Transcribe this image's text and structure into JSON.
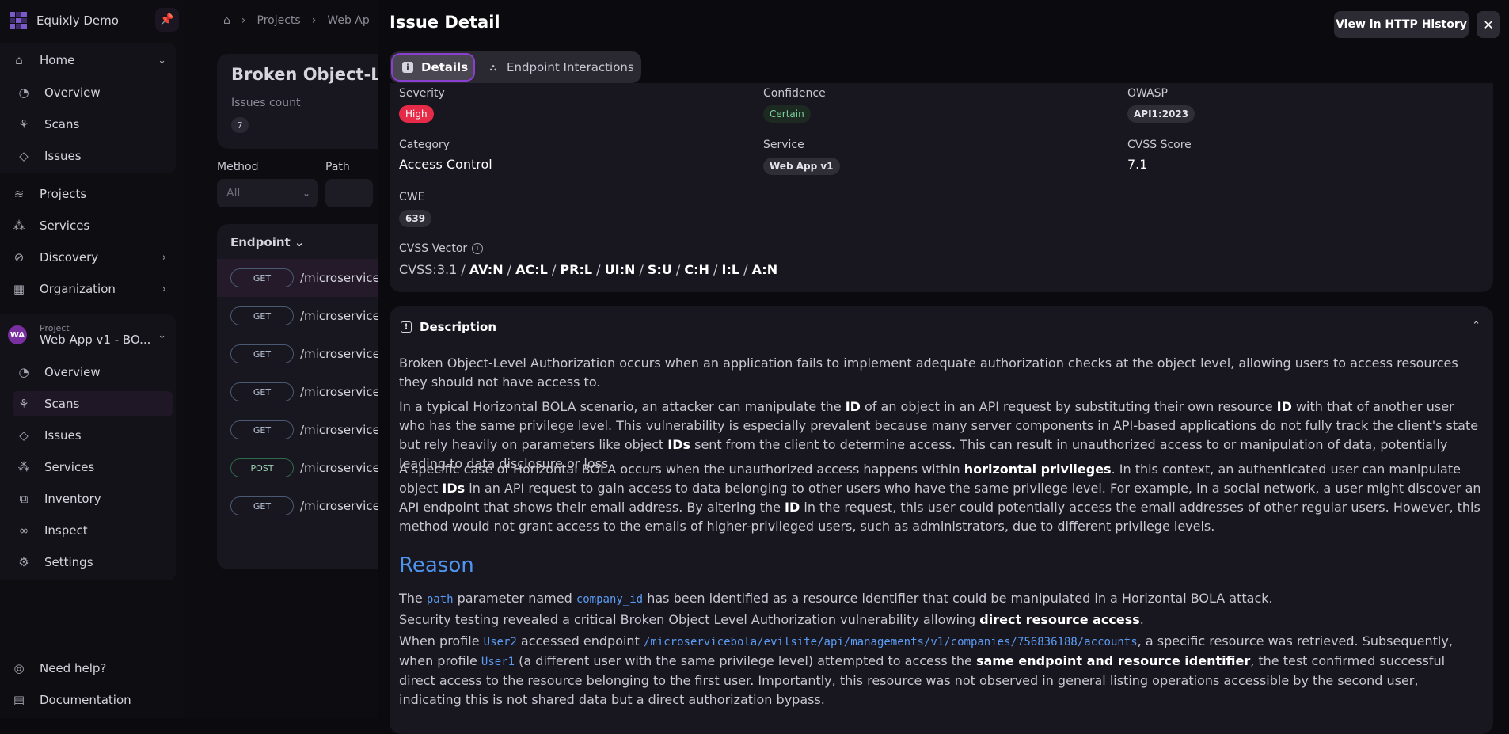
{
  "sidebar": {
    "brand": "Equixly Demo",
    "home": "Home",
    "home_items": [
      "Overview",
      "Scans",
      "Issues"
    ],
    "projects": "Projects",
    "services": "Services",
    "discovery": "Discovery",
    "organization": "Organization",
    "project_label": "Project",
    "project_name": "Web App v1 - BO...",
    "project_badge": "WA",
    "project_items": [
      "Overview",
      "Scans",
      "Issues",
      "Services",
      "Inventory",
      "Inspect",
      "Settings"
    ],
    "need_help": "Need help?",
    "documentation": "Documentation"
  },
  "main": {
    "breadcrumb": [
      "Projects",
      "Web Ap"
    ],
    "issue_title": "Broken Object-Lev",
    "issues_count_label": "Issues count",
    "issues_count": "7",
    "filter_method_label": "Method",
    "filter_method_value": "All",
    "filter_path_label": "Path",
    "endpoint_header": "Endpoint",
    "rows": [
      {
        "method": "GET",
        "path": "/microserviceb"
      },
      {
        "method": "GET",
        "path": "/microserviceb"
      },
      {
        "method": "GET",
        "path": "/microserviceb"
      },
      {
        "method": "GET",
        "path": "/microserviceb"
      },
      {
        "method": "GET",
        "path": "/microserviceb"
      },
      {
        "method": "POST",
        "path": "/microserviceb"
      },
      {
        "method": "GET",
        "path": "/microserviceb"
      }
    ]
  },
  "panel": {
    "title": "Issue Detail",
    "http_history": "View in HTTP History",
    "close": "✕",
    "tab_details": "Details",
    "tab_interactions": "Endpoint Interactions",
    "severity_label": "Severity",
    "severity": "High",
    "confidence_label": "Confidence",
    "confidence": "Certain",
    "owasp_label": "OWASP",
    "owasp": "API1:2023",
    "category_label": "Category",
    "category": "Access Control",
    "service_label": "Service",
    "service": "Web App v1",
    "cvss_score_label": "CVSS Score",
    "cvss_score": "7.1",
    "cwe_label": "CWE",
    "cwe": "639",
    "cvss_vector_label": "CVSS Vector",
    "cvss_prefix": "CVSS:3.1",
    "cvss_parts": [
      "AV:N",
      "AC:L",
      "PR:L",
      "UI:N",
      "S:U",
      "C:H",
      "I:L",
      "A:N"
    ],
    "description_title": "Description",
    "desc_p1": "Broken Object-Level Authorization occurs when an application fails to implement adequate authorization checks at the object level, allowing users to access resources they should not have access to.",
    "desc_p2": {
      "a": "In a typical Horizontal BOLA scenario, an attacker can manipulate the ",
      "b1": "ID",
      "c": " of an object in an API request by substituting their own resource ",
      "b2": "ID",
      "d": " with that of another user who has the same privilege level. This vulnerability is especially prevalent because many server components in API-based applications do not fully track the client's state but rely heavily on parameters like object ",
      "b3": "IDs",
      "e": " sent from the client to determine access. This can result in unauthorized access to or manipulation of data, potentially leading to data disclosure or loss."
    },
    "desc_p3": {
      "a": "A specific case of Horizontal BOLA occurs when the unauthorized access happens within ",
      "b1": "horizontal privileges",
      "c": ". In this context, an authenticated user can manipulate object ",
      "b2": "IDs",
      "d": " in an API request to gain access to data belonging to other users who have the same privilege level. For example, in a social network, a user might discover an API endpoint that shows their email address. By altering the ",
      "b3": "ID",
      "e": " in the request, this user could potentially access the email addresses of other regular users. However, this method would not grant access to the emails of higher-privileged users, such as administrators, due to different privilege levels."
    },
    "reason_title": "Reason",
    "reason_p1": {
      "a": "The ",
      "code1": "path",
      "b": " parameter named ",
      "code2": "company_id",
      "c": " has been identified as a resource identifier that could be manipulated in a Horizontal BOLA attack."
    },
    "reason_p2": {
      "a": "Security testing revealed a critical Broken Object Level Authorization vulnerability allowing ",
      "b1": "direct resource access",
      "c": "."
    },
    "reason_p3": {
      "a": "When profile ",
      "code1": "User2",
      "b": " accessed endpoint ",
      "code2": "/microservicebola/evilsite/api/managements/v1/companies/756836188/accounts",
      "c": ", a specific resource was retrieved. Subsequently, when profile ",
      "code3": "User1",
      "d": " (a different user with the same privilege level) attempted to access the ",
      "b1": "same endpoint and resource identifier",
      "e": ", the test confirmed successful direct access to the resource belonging to the first user. Importantly, this resource was not observed in general listing operations accessible by the second user, indicating this is not shared data but a direct authorization bypass."
    }
  }
}
